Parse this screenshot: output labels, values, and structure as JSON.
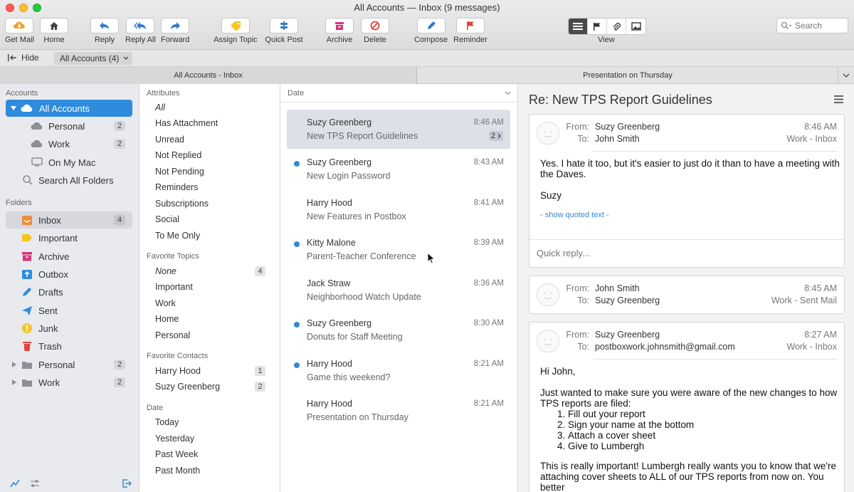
{
  "window": {
    "title": "All Accounts — Inbox (9 messages)"
  },
  "toolbar": {
    "buttons": [
      {
        "label": "Get Mail"
      },
      {
        "label": "Home"
      },
      {
        "label": "Reply"
      },
      {
        "label": "Reply All"
      },
      {
        "label": "Forward"
      },
      {
        "label": "Assign Topic"
      },
      {
        "label": "Quick Post"
      },
      {
        "label": "Archive"
      },
      {
        "label": "Delete"
      },
      {
        "label": "Compose"
      },
      {
        "label": "Reminder"
      }
    ],
    "view_label": "View",
    "search_placeholder": "Search"
  },
  "bar2": {
    "hide_label": "Hide",
    "account_select": "All Accounts (4)"
  },
  "tabs": [
    {
      "label": "All Accounts - Inbox"
    },
    {
      "label": "Presentation on Thursday"
    }
  ],
  "sidebar": {
    "accounts_heading": "Accounts",
    "accounts": [
      {
        "label": "All Accounts",
        "badge": ""
      },
      {
        "label": "Personal",
        "badge": "2"
      },
      {
        "label": "Work",
        "badge": "2"
      },
      {
        "label": "On My Mac",
        "badge": ""
      },
      {
        "label": "Search All Folders",
        "badge": ""
      }
    ],
    "folders_heading": "Folders",
    "folders": [
      {
        "label": "Inbox",
        "badge": "4"
      },
      {
        "label": "Important",
        "badge": ""
      },
      {
        "label": "Archive",
        "badge": ""
      },
      {
        "label": "Outbox",
        "badge": ""
      },
      {
        "label": "Drafts",
        "badge": ""
      },
      {
        "label": "Sent",
        "badge": ""
      },
      {
        "label": "Junk",
        "badge": ""
      },
      {
        "label": "Trash",
        "badge": ""
      },
      {
        "label": "Personal",
        "badge": "2"
      },
      {
        "label": "Work",
        "badge": "2"
      }
    ]
  },
  "attributes": {
    "heading": "Attributes",
    "items": [
      "All",
      "Has Attachment",
      "Unread",
      "Not Replied",
      "Not Pending",
      "Reminders",
      "Subscriptions",
      "Social",
      "To Me Only"
    ],
    "topics_heading": "Favorite Topics",
    "topics": [
      {
        "label": "None",
        "badge": "4"
      },
      {
        "label": "Important",
        "badge": ""
      },
      {
        "label": "Work",
        "badge": ""
      },
      {
        "label": "Home",
        "badge": ""
      },
      {
        "label": "Personal",
        "badge": ""
      }
    ],
    "contacts_heading": "Favorite Contacts",
    "contacts": [
      {
        "label": "Harry Hood",
        "badge": "1"
      },
      {
        "label": "Suzy Greenberg",
        "badge": "2"
      }
    ],
    "date_heading": "Date",
    "dates": [
      "Today",
      "Yesterday",
      "Past Week",
      "Past Month"
    ]
  },
  "messagelist": {
    "sort_label": "Date",
    "messages": [
      {
        "from": "Suzy Greenberg",
        "subject": "New TPS Report Guidelines",
        "time": "8:46 AM",
        "count": "2",
        "unread": false,
        "selected": true
      },
      {
        "from": "Suzy Greenberg",
        "subject": "New Login Password",
        "time": "8:43 AM",
        "unread": true
      },
      {
        "from": "Harry Hood",
        "subject": "New Features in Postbox",
        "time": "8:41 AM",
        "unread": false
      },
      {
        "from": "Kitty Malone",
        "subject": "Parent-Teacher Conference",
        "time": "8:39 AM",
        "unread": true
      },
      {
        "from": "Jack Straw",
        "subject": "Neighborhood Watch Update",
        "time": "8:36 AM",
        "unread": false
      },
      {
        "from": "Suzy Greenberg",
        "subject": "Donuts for Staff Meeting",
        "time": "8:30 AM",
        "unread": true
      },
      {
        "from": "Harry Hood",
        "subject": "Game this weekend?",
        "time": "8:21 AM",
        "unread": true
      },
      {
        "from": "Harry Hood",
        "subject": "Presentation on Thursday",
        "time": "8:21 AM",
        "unread": false
      }
    ]
  },
  "reader": {
    "subject": "Re: New TPS Report Guidelines",
    "from_label": "From:",
    "to_label": "To:",
    "messages": [
      {
        "from": "Suzy Greenberg",
        "to": "John Smith",
        "time": "8:46 AM",
        "folder": "Work - Inbox"
      },
      {
        "from": "John Smith",
        "to": "Suzy Greenberg",
        "time": "8:45 AM",
        "folder": "Work - Sent Mail"
      },
      {
        "from": "Suzy Greenberg",
        "to": "postboxwork.johnsmith@gmail.com",
        "time": "8:27 AM",
        "folder": "Work - Inbox"
      }
    ],
    "msg1_body": [
      "Yes. I hate it too, but it's easier to just do it than to have a meeting with",
      "the Daves."
    ],
    "msg1_sign": "Suzy",
    "show_quoted": "- show quoted text -",
    "quick_reply_placeholder": "Quick reply...",
    "msg3_greeting": "Hi John,",
    "msg3_intro": [
      "Just wanted to make sure you were aware of the new changes to how",
      "TPS reports are filed:"
    ],
    "msg3_list": [
      "Fill out your report",
      "Sign your name at the bottom",
      "Attach a cover sheet",
      "Give to Lumbergh"
    ],
    "msg3_outro": [
      "This is really important! Lumbergh really wants you to know that we're",
      "attaching cover sheets to ALL of our TPS reports from now on. You better"
    ]
  },
  "colors": {
    "accent": "#2f8bdb",
    "selection": "#dde1e7",
    "sidebar_bg": "#e9eaee"
  }
}
